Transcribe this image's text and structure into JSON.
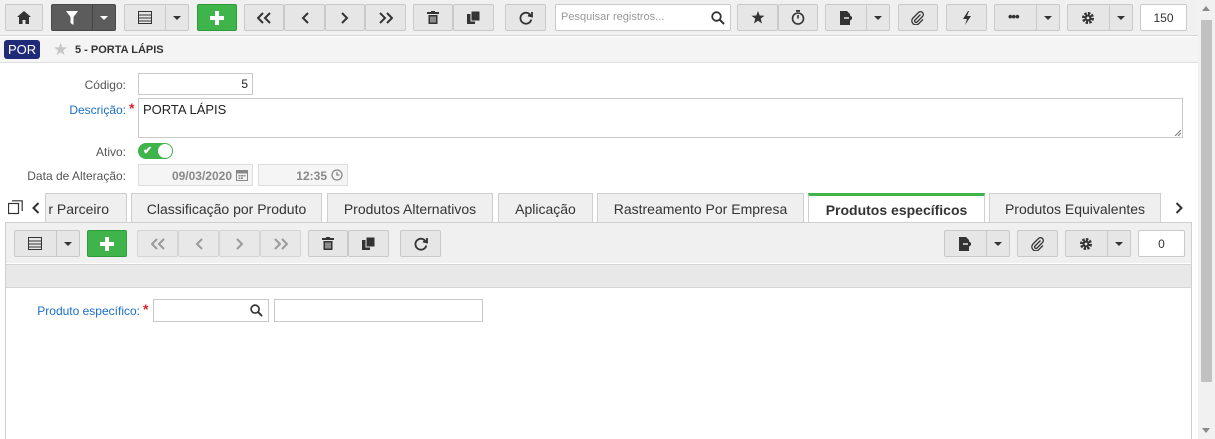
{
  "toolbar": {
    "search_placeholder": "Pesquisar registros...",
    "record_count": "150"
  },
  "record": {
    "badge": "POR",
    "title": "5 - PORTA LÁPIS"
  },
  "form": {
    "codigo_label": "Código:",
    "codigo_value": "5",
    "descricao_label": "Descrição:",
    "descricao_value": "PORTA LÁPIS",
    "ativo_label": "Ativo:",
    "ativo_value": true,
    "data_label": "Data de Alteração:",
    "data_value": "09/03/2020",
    "hora_value": "12:35"
  },
  "tabs": [
    {
      "label": "r Parceiro"
    },
    {
      "label": "Classificação por Produto"
    },
    {
      "label": "Produtos Alternativos"
    },
    {
      "label": "Aplicação"
    },
    {
      "label": "Rastreamento Por Empresa"
    },
    {
      "label": "Produtos específicos",
      "active": true
    },
    {
      "label": "Produtos Equivalentes"
    }
  ],
  "detail": {
    "record_count": "0",
    "produto_label": "Produto específico:",
    "produto_code": "",
    "produto_desc": ""
  },
  "colors": {
    "accent_green": "#3fb44a",
    "badge_blue": "#1f2a78",
    "required_label": "#1a6fc9",
    "required_star": "#d9232a"
  }
}
